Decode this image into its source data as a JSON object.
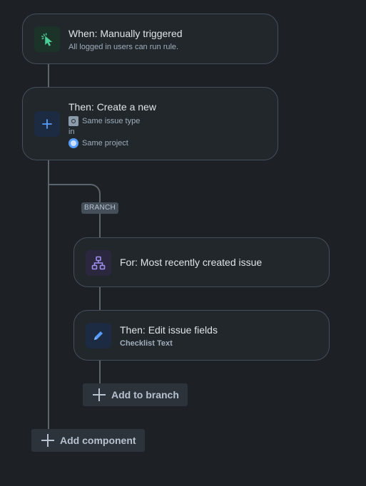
{
  "trigger": {
    "title": "When: Manually triggered",
    "subtitle": "All logged in users can run rule.",
    "icon": "cursor-click-icon",
    "accent": "#4bce97"
  },
  "create_action": {
    "title": "Then: Create a new",
    "issue_type": "Same issue type",
    "connector_word": "in",
    "project": "Same project",
    "icon": "plus-icon",
    "accent": "#579dff"
  },
  "branch": {
    "label": "BRANCH",
    "for_card": {
      "title": "For: Most recently created issue",
      "icon": "branch-hierarchy-icon",
      "accent": "#9f8fef"
    },
    "edit_card": {
      "title": "Then: Edit issue fields",
      "detail": "Checklist Text",
      "icon": "pencil-icon",
      "accent": "#579dff"
    },
    "add_button_label": "Add to branch"
  },
  "add_component_label": "Add component"
}
